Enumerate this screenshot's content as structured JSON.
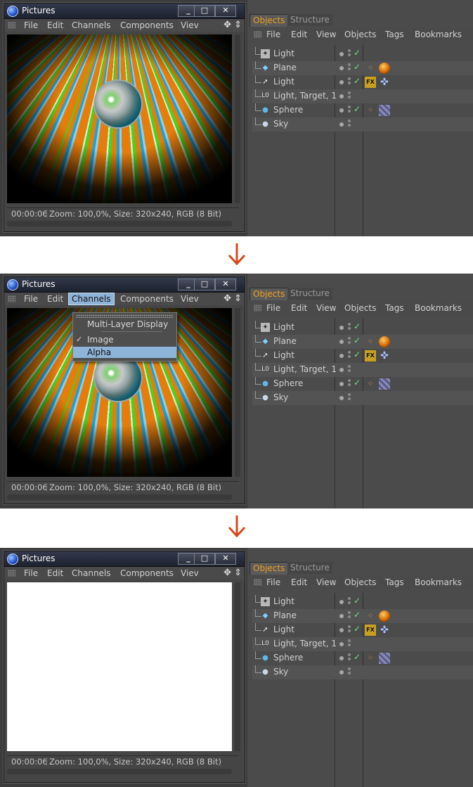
{
  "picture_viewer": {
    "title": "Pictures",
    "window_buttons": [
      "_",
      "□",
      "✕"
    ],
    "menu": [
      "File",
      "Edit",
      "Channels",
      "Components",
      "Viev"
    ],
    "status": {
      "time": "00:00:06",
      "info": "Zoom: 100,0%, Size: 320x240, RGB (8 Bit)"
    }
  },
  "channels_menu": {
    "items": [
      "Multi-Layer Display",
      "Image",
      "Alpha"
    ],
    "checked": "Image",
    "highlighted": "Alpha"
  },
  "object_manager": {
    "tabs": [
      "Objects",
      "Structure"
    ],
    "menu": [
      "File",
      "Edit",
      "View",
      "Objects",
      "Tags",
      "Bookmarks"
    ],
    "objects": [
      {
        "name": "Light",
        "icon": "light-icon",
        "tags": []
      },
      {
        "name": "Plane",
        "icon": "plane-icon",
        "tags": [
          "phong-tag-icon",
          "material-tag-icon"
        ]
      },
      {
        "name": "Light",
        "icon": "spotlight-icon",
        "tags": [
          "fx-tag-icon",
          "target-tag-icon"
        ]
      },
      {
        "name": "Light, Target, 1",
        "icon": "null-object-icon",
        "tags": []
      },
      {
        "name": "Sphere",
        "icon": "sphere-icon",
        "tags": [
          "phong-tag-icon",
          "texture-tag-icon"
        ]
      },
      {
        "name": "Sky",
        "icon": "sky-icon",
        "tags": []
      }
    ]
  },
  "colors": {
    "accent_tab": "#f0a020",
    "menu_highlight": "#8fb4d9",
    "arrow": "#d04a1a",
    "check": "#6fe07a"
  }
}
